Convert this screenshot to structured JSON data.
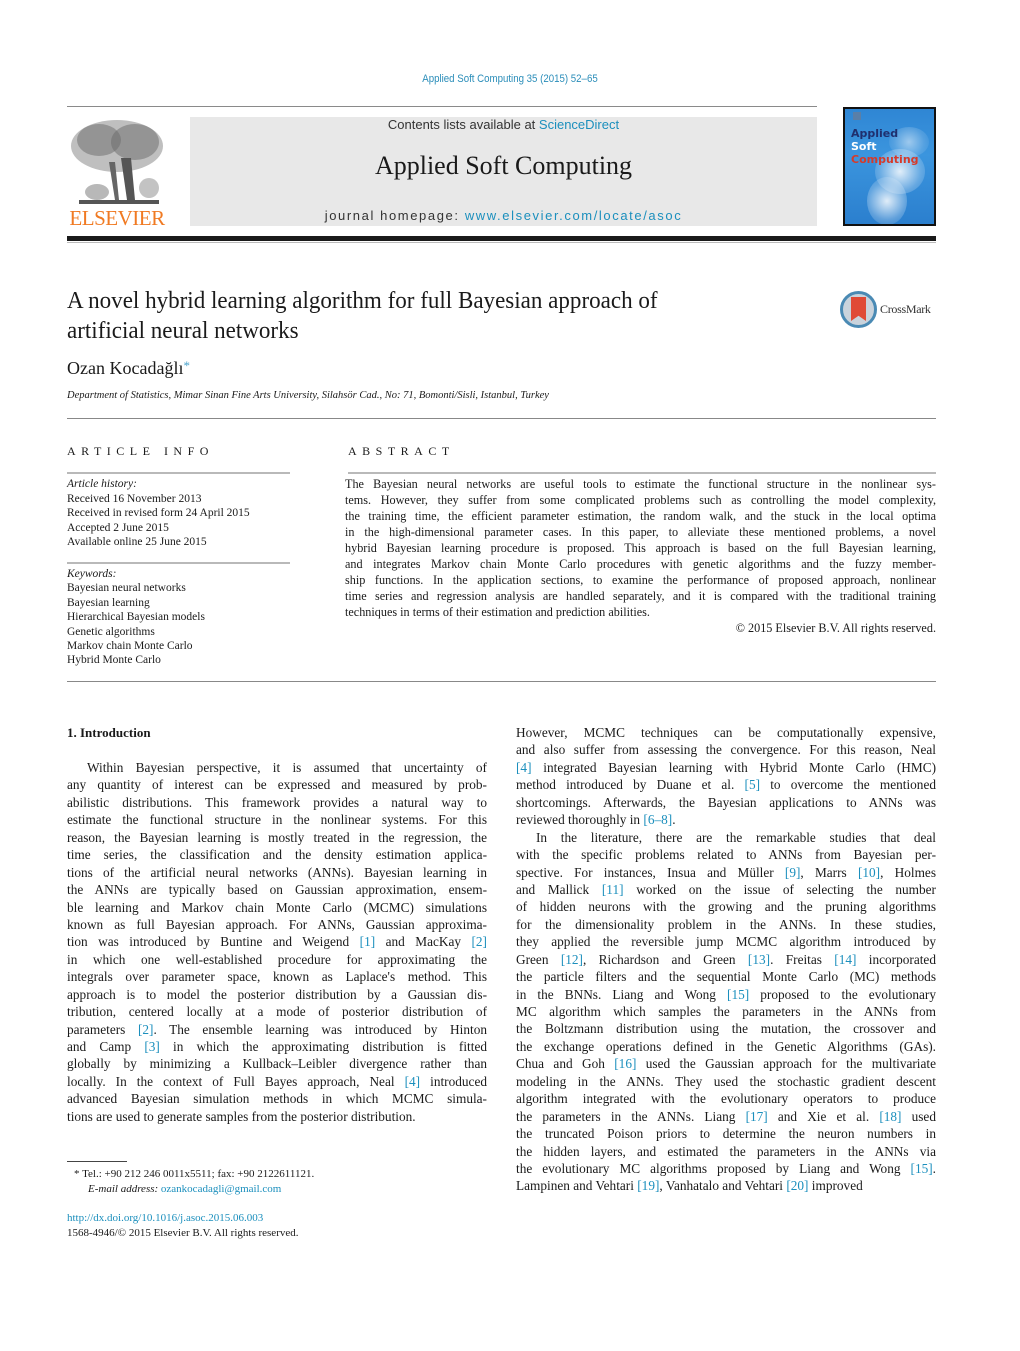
{
  "journal_ref": "Applied Soft Computing 35 (2015) 52–65",
  "header": {
    "publisher_name": "ELSEVIER",
    "contents_prefix": "Contents lists available at ",
    "contents_link": "ScienceDirect",
    "journal_title": "Applied Soft Computing",
    "homepage_prefix": "journal homepage: ",
    "homepage_link": "www.elsevier.com/locate/asoc",
    "cover": {
      "line1": "Applied",
      "line2": "Soft",
      "line3": "Computing"
    }
  },
  "article": {
    "title_line1": "A novel hybrid learning algorithm for full Bayesian approach of",
    "title_line2": "artificial neural networks",
    "crossmark_label": "CrossMark",
    "author": "Ozan Kocadağlı",
    "author_mark": "*",
    "affiliation": "Department of Statistics, Mimar Sinan Fine Arts University, Silahsör Cad., No: 71, Bomonti/Sisli, Istanbul, Turkey"
  },
  "article_info": {
    "heading": "ARTICLE INFO",
    "history_label": "Article history:",
    "history": [
      "Received 16 November 2013",
      "Received in revised form 24 April 2015",
      "Accepted 2 June 2015",
      "Available online 25 June 2015"
    ],
    "keywords_label": "Keywords:",
    "keywords": [
      "Bayesian neural networks",
      "Bayesian learning",
      "Hierarchical Bayesian models",
      "Genetic algorithms",
      "Markov chain Monte Carlo",
      "Hybrid Monte Carlo"
    ]
  },
  "abstract": {
    "heading": "ABSTRACT",
    "lines": [
      "The Bayesian neural networks are useful tools to estimate the functional structure in the nonlinear sys-",
      "tems. However, they suffer from some complicated problems such as controlling the model complexity,",
      "the training time, the efficient parameter estimation, the random walk, and the stuck in the local optima",
      "in the high-dimensional parameter cases. In this paper, to alleviate these mentioned problems, a novel",
      "hybrid Bayesian learning procedure is proposed. This approach is based on the full Bayesian learning,",
      "and integrates Markov chain Monte Carlo procedures with genetic algorithms and the fuzzy member-",
      "ship functions. In the application sections, to examine the performance of proposed approach, nonlinear",
      "time series and regression analysis are handled separately, and it is compared with the traditional training",
      "techniques in terms of their estimation and prediction abilities."
    ],
    "copyright": "© 2015 Elsevier B.V. All rights reserved."
  },
  "introduction": {
    "heading": "1.  Introduction",
    "left_column": [
      [
        {
          "t": "Within Bayesian perspective, it is assumed that uncertainty of"
        }
      ],
      [
        {
          "t": "any quantity of interest can be expressed and measured by prob-"
        }
      ],
      [
        {
          "t": "abilistic distributions. This framework provides a natural way to"
        }
      ],
      [
        {
          "t": "estimate the functional structure in the nonlinear systems. For this"
        }
      ],
      [
        {
          "t": "reason, the Bayesian learning is mostly treated in the regression, the"
        }
      ],
      [
        {
          "t": "time series, the classification and the density estimation applica-"
        }
      ],
      [
        {
          "t": "tions of the artificial neural networks (ANNs). Bayesian learning in"
        }
      ],
      [
        {
          "t": "the ANNs are typically based on Gaussian approximation, ensem-"
        }
      ],
      [
        {
          "t": "ble learning and Markov chain Monte Carlo (MCMC) simulations"
        }
      ],
      [
        {
          "t": "known as full Bayesian approach. For ANNs, Gaussian approxima-"
        }
      ],
      [
        {
          "t": "tion was introduced by Buntine and Weigend "
        },
        {
          "t": "[1]",
          "ref": true
        },
        {
          "t": " and MacKay "
        },
        {
          "t": "[2]",
          "ref": true
        }
      ],
      [
        {
          "t": "in which one well-established procedure for approximating the"
        }
      ],
      [
        {
          "t": "integrals over parameter space, known as Laplace's method. This"
        }
      ],
      [
        {
          "t": "approach is to model the posterior distribution by a Gaussian dis-"
        }
      ],
      [
        {
          "t": "tribution, centered locally at a mode of posterior distribution of"
        }
      ],
      [
        {
          "t": "parameters "
        },
        {
          "t": "[2]",
          "ref": true
        },
        {
          "t": ". The ensemble learning was introduced by Hinton"
        }
      ],
      [
        {
          "t": "and Camp "
        },
        {
          "t": "[3]",
          "ref": true
        },
        {
          "t": " in which the approximating distribution is fitted"
        }
      ],
      [
        {
          "t": "globally by minimizing a Kullback–Leibler divergence rather than"
        }
      ],
      [
        {
          "t": "locally. In the context of Full Bayes approach, Neal "
        },
        {
          "t": "[4]",
          "ref": true
        },
        {
          "t": " introduced"
        }
      ],
      [
        {
          "t": "advanced Bayesian simulation methods in which MCMC simula-"
        }
      ],
      [
        {
          "t": "tions are used to generate samples from the posterior distribution."
        }
      ]
    ],
    "right_column": [
      [
        {
          "t": "However, MCMC techniques can be computationally expensive,"
        }
      ],
      [
        {
          "t": "and also suffer from assessing the convergence. For this reason, Neal"
        }
      ],
      [
        {
          "t": "[4]",
          "ref": true
        },
        {
          "t": " integrated Bayesian learning with Hybrid Monte Carlo (HMC)"
        }
      ],
      [
        {
          "t": "method introduced by Duane et al. "
        },
        {
          "t": "[5]",
          "ref": true
        },
        {
          "t": " to overcome the mentioned"
        }
      ],
      [
        {
          "t": "shortcomings. Afterwards, the Bayesian applications to ANNs was"
        }
      ],
      [
        {
          "t": "reviewed thoroughly in "
        },
        {
          "t": "[6–8]",
          "ref": true
        },
        {
          "t": "."
        }
      ],
      [
        {
          "t": "In the literature, there are the remarkable studies that deal"
        }
      ],
      [
        {
          "t": "with the specific problems related to ANNs from Bayesian per-"
        }
      ],
      [
        {
          "t": "spective. For instances, Insua and Müller "
        },
        {
          "t": "[9]",
          "ref": true
        },
        {
          "t": ", Marrs "
        },
        {
          "t": "[10]",
          "ref": true
        },
        {
          "t": ", Holmes"
        }
      ],
      [
        {
          "t": "and Mallick "
        },
        {
          "t": "[11]",
          "ref": true
        },
        {
          "t": " worked on the issue of selecting the number"
        }
      ],
      [
        {
          "t": "of hidden neurons with the growing and the pruning algorithms"
        }
      ],
      [
        {
          "t": "for the dimensionality problem in the ANNs. In these studies,"
        }
      ],
      [
        {
          "t": "they applied the reversible jump MCMC algorithm introduced by"
        }
      ],
      [
        {
          "t": "Green "
        },
        {
          "t": "[12]",
          "ref": true
        },
        {
          "t": ", Richardson and Green "
        },
        {
          "t": "[13]",
          "ref": true
        },
        {
          "t": ". Freitas "
        },
        {
          "t": "[14]",
          "ref": true
        },
        {
          "t": " incorporated"
        }
      ],
      [
        {
          "t": "the particle filters and the sequential Monte Carlo (MC) methods"
        }
      ],
      [
        {
          "t": "in the BNNs. Liang and Wong "
        },
        {
          "t": "[15]",
          "ref": true
        },
        {
          "t": " proposed to the evolutionary"
        }
      ],
      [
        {
          "t": "MC algorithm which samples the parameters in the ANNs from"
        }
      ],
      [
        {
          "t": "the Boltzmann distribution using the mutation, the crossover and"
        }
      ],
      [
        {
          "t": "the exchange operations defined in the Genetic Algorithms (GAs)."
        }
      ],
      [
        {
          "t": "Chua and Goh "
        },
        {
          "t": "[16]",
          "ref": true
        },
        {
          "t": " used the Gaussian approach for the multivariate"
        }
      ],
      [
        {
          "t": "modeling in the ANNs. They used the stochastic gradient descent"
        }
      ],
      [
        {
          "t": "algorithm integrated with the evolutionary operators to produce"
        }
      ],
      [
        {
          "t": "the parameters in the ANNs. Liang "
        },
        {
          "t": "[17]",
          "ref": true
        },
        {
          "t": " and Xie et al. "
        },
        {
          "t": "[18]",
          "ref": true
        },
        {
          "t": " used"
        }
      ],
      [
        {
          "t": "the truncated Poison priors to determine the neuron numbers in"
        }
      ],
      [
        {
          "t": "the hidden layers, and estimated the parameters in the ANNs via"
        }
      ],
      [
        {
          "t": "the evolutionary MC algorithms proposed by Liang and Wong "
        },
        {
          "t": "[15]",
          "ref": true
        },
        {
          "t": "."
        }
      ],
      [
        {
          "t": "Lampinen and Vehtari "
        },
        {
          "t": "[19]",
          "ref": true
        },
        {
          "t": ", Vanhatalo and Vehtari "
        },
        {
          "t": "[20]",
          "ref": true
        },
        {
          "t": " improved"
        }
      ]
    ]
  },
  "footnote": {
    "mark": "*",
    "contact": "Tel.: +90 212 246 0011x5511; fax: +90 2122611121.",
    "email_label": "E-mail address: ",
    "email": "ozankocadagli@gmail.com"
  },
  "doi": {
    "link": "http://dx.doi.org/10.1016/j.asoc.2015.06.003",
    "issn_line": "1568-4946/© 2015 Elsevier B.V. All rights reserved."
  }
}
